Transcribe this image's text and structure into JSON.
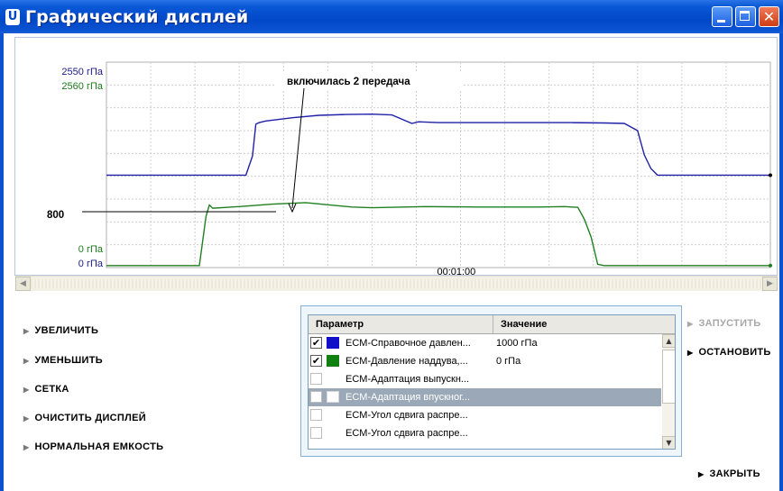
{
  "window": {
    "title": "Графический дисплей",
    "icon": "app-icon",
    "controls": [
      "minimize-icon",
      "maximize-icon",
      "close-icon"
    ]
  },
  "chart": {
    "y_labels": {
      "series1_max": "2550 гПа",
      "series2_max": "2560 гПа",
      "series2_min": "0 гПа",
      "series1_min": "0 гПа"
    },
    "x_tick_label": "00:01:00",
    "annotation": "включилась 2 передача",
    "marker_label": "800"
  },
  "chart_data": {
    "type": "line",
    "grid": true,
    "series": [
      {
        "name": "ECM-Справочное давлен...",
        "color": "#2020a8",
        "ylim": [
          0,
          2550
        ],
        "points": [
          [
            0,
            1147
          ],
          [
            0.21,
            1147
          ],
          [
            0.22,
            1385
          ],
          [
            0.225,
            1780
          ],
          [
            0.23,
            1800
          ],
          [
            0.24,
            1820
          ],
          [
            0.28,
            1860
          ],
          [
            0.32,
            1890
          ],
          [
            0.36,
            1900
          ],
          [
            0.4,
            1905
          ],
          [
            0.43,
            1895
          ],
          [
            0.46,
            1790
          ],
          [
            0.47,
            1810
          ],
          [
            0.5,
            1800
          ],
          [
            0.7,
            1800
          ],
          [
            0.75,
            1795
          ],
          [
            0.78,
            1790
          ],
          [
            0.8,
            1700
          ],
          [
            0.81,
            1400
          ],
          [
            0.82,
            1230
          ],
          [
            0.83,
            1147
          ],
          [
            1,
            1147
          ]
        ]
      },
      {
        "name": "ECM-Давление наддува...",
        "color": "#208020",
        "ylim": [
          0,
          2560
        ],
        "points": [
          [
            0,
            25
          ],
          [
            0.14,
            25
          ],
          [
            0.15,
            640
          ],
          [
            0.155,
            780
          ],
          [
            0.16,
            740
          ],
          [
            0.2,
            760
          ],
          [
            0.25,
            790
          ],
          [
            0.3,
            810
          ],
          [
            0.33,
            785
          ],
          [
            0.37,
            755
          ],
          [
            0.4,
            745
          ],
          [
            0.48,
            760
          ],
          [
            0.56,
            755
          ],
          [
            0.65,
            755
          ],
          [
            0.69,
            760
          ],
          [
            0.71,
            750
          ],
          [
            0.72,
            600
          ],
          [
            0.73,
            380
          ],
          [
            0.74,
            40
          ],
          [
            0.75,
            25
          ],
          [
            1,
            25
          ]
        ]
      }
    ],
    "annotations": [
      "включилась 2 передача",
      "800"
    ]
  },
  "scrollbar": {
    "left_arrow": "◀",
    "right_arrow": "▶"
  },
  "side_buttons": [
    {
      "label": "УВЕЛИЧИТЬ"
    },
    {
      "label": "УМЕНЬШИТЬ"
    },
    {
      "label": "СЕТКА"
    },
    {
      "label": "ОЧИСТИТЬ ДИСПЛЕЙ"
    },
    {
      "label": "НОРМАЛЬНАЯ ЕМКОСТЬ"
    }
  ],
  "table": {
    "headers": [
      "Параметр",
      "Значение"
    ],
    "rows": [
      {
        "name": "ECM-Справочное давлен...",
        "value": "1000 гПа",
        "checked": "✔",
        "color": "#1010c8"
      },
      {
        "name": "ECM-Давление наддува,...",
        "value": "0 гПа",
        "checked": "✔",
        "color": "#108010"
      },
      {
        "name": "ECM-Адаптация выпускн...",
        "value": "",
        "checked": "",
        "color": ""
      },
      {
        "name": "ECM-Адаптация впускног...",
        "value": "",
        "checked": "",
        "color": "",
        "selected": true
      },
      {
        "name": "ECM-Угол сдвига распре...",
        "value": "",
        "checked": "",
        "color": ""
      },
      {
        "name": "ECM-Угол сдвига распре...",
        "value": "",
        "checked": "",
        "color": ""
      }
    ]
  },
  "actions": {
    "start": "ЗАПУСТИТЬ",
    "stop": "ОСТАНОВИТЬ",
    "close": "ЗАКРЫТЬ"
  },
  "arrow_glyph": "▶",
  "colors": {
    "titlebar": "#0048c8",
    "series1": "#2020a8",
    "series2": "#208020",
    "selected_row": "#9aa8b8",
    "disabled_text": "#a0a0a0"
  }
}
